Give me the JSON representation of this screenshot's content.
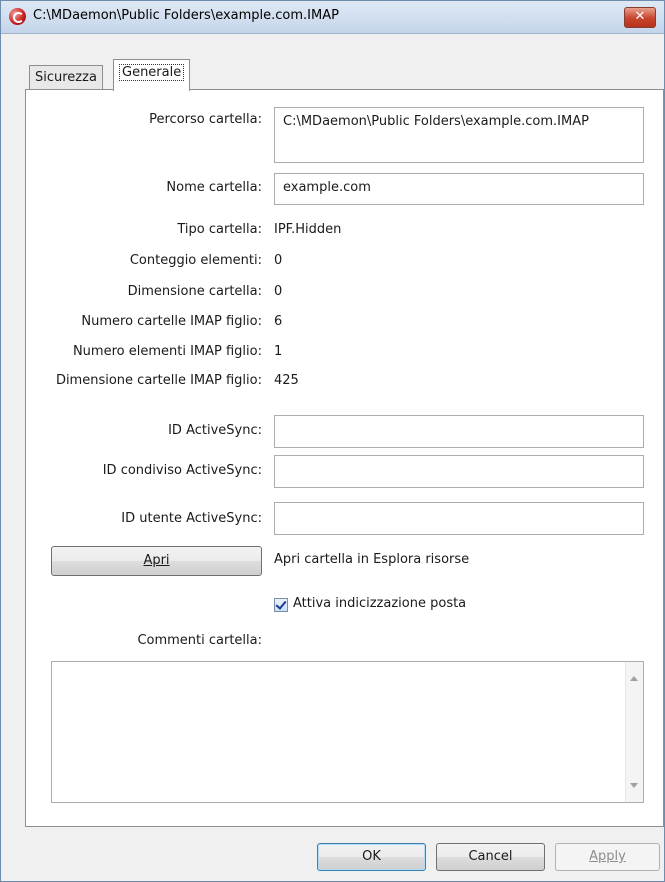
{
  "window": {
    "title": "C:\\MDaemon\\Public Folders\\example.com.IMAP",
    "close_label": "✕",
    "accent_color": "#c7432c"
  },
  "tabs": [
    {
      "label": "Sicurezza",
      "selected": false
    },
    {
      "label": "Generale",
      "selected": true
    }
  ],
  "general": {
    "folder_path_label": "Percorso cartella:",
    "folder_path_value": "C:\\MDaemon\\Public Folders\\example.com.IMAP",
    "folder_name_label": "Nome cartella:",
    "folder_name_value": "example.com",
    "folder_type_label": "Tipo cartella:",
    "folder_type_value": "IPF.Hidden",
    "item_count_label": "Conteggio elementi:",
    "item_count_value": "0",
    "folder_size_label": "Dimensione cartella:",
    "folder_size_value": "0",
    "child_folders_label": "Numero cartelle IMAP figlio:",
    "child_folders_value": "6",
    "child_items_label": "Numero elementi IMAP figlio:",
    "child_items_value": "1",
    "child_size_label": "Dimensione cartelle IMAP figlio:",
    "child_size_value": "425",
    "activesync_id_label": "ID ActiveSync:",
    "activesync_id_value": "",
    "activesync_shared_label": "ID condiviso ActiveSync:",
    "activesync_shared_value": "",
    "activesync_user_label": "ID utente ActiveSync:",
    "activesync_user_value": "",
    "open_button_label": "Apri",
    "open_description": "Apri cartella in Esplora risorse",
    "indexing_label": "Attiva indicizzazione posta",
    "indexing_checked": true,
    "comments_label": "Commenti cartella:",
    "comments_value": ""
  },
  "footer": {
    "ok_label": "OK",
    "cancel_label": "Cancel",
    "apply_label": "Apply"
  }
}
